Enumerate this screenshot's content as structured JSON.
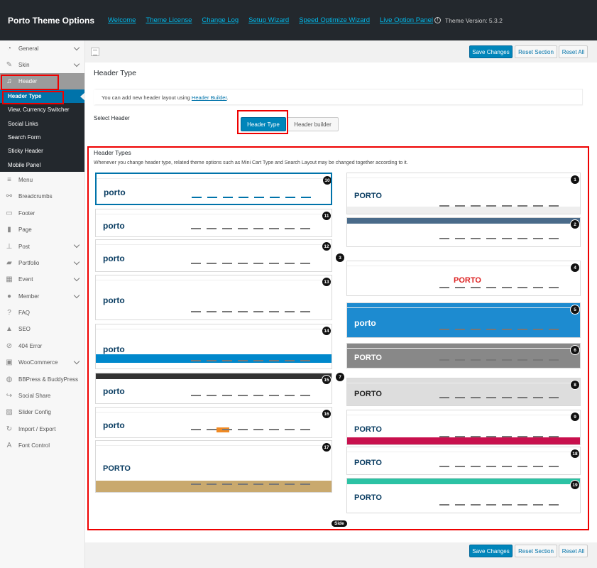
{
  "topbar": {
    "brand": "Porto Theme Options",
    "links": [
      "Welcome",
      "Theme License",
      "Change Log",
      "Setup Wizard",
      "Speed Optimize Wizard",
      "Live Option Panel"
    ],
    "version": "Theme Version: 5.3.2"
  },
  "sidebar": {
    "items": [
      {
        "label": "General",
        "icon": "gauge-icon",
        "chev": true
      },
      {
        "label": "Skin",
        "icon": "brush-icon",
        "chev": true
      },
      {
        "label": "Header",
        "icon": "headphones-icon",
        "chev": false
      }
    ],
    "sub_items": [
      "Header Type",
      "View, Currency Switcher",
      "Social Links",
      "Search Form",
      "Sticky Header",
      "Mobile Panel"
    ],
    "items_after": [
      {
        "label": "Menu",
        "icon": "menu-icon",
        "chev": false
      },
      {
        "label": "Breadcrumbs",
        "icon": "link-icon",
        "chev": false
      },
      {
        "label": "Footer",
        "icon": "layout-icon",
        "chev": false
      },
      {
        "label": "Page",
        "icon": "bookmark-icon",
        "chev": false
      },
      {
        "label": "Post",
        "icon": "thumbtack-icon",
        "chev": true
      },
      {
        "label": "Portfolio",
        "icon": "folder-icon",
        "chev": true
      },
      {
        "label": "Event",
        "icon": "calendar-icon",
        "chev": true
      },
      {
        "label": "Member",
        "icon": "user-icon",
        "chev": true
      },
      {
        "label": "FAQ",
        "icon": "question-icon",
        "chev": false
      },
      {
        "label": "SEO",
        "icon": "thumbs-up-icon",
        "chev": false
      },
      {
        "label": "404 Error",
        "icon": "error-icon",
        "chev": false
      },
      {
        "label": "WooCommerce",
        "icon": "cart-icon",
        "chev": true
      },
      {
        "label": "BBPress & BuddyPress",
        "icon": "group-icon",
        "chev": false
      },
      {
        "label": "Social Share",
        "icon": "share-icon",
        "chev": false
      },
      {
        "label": "Slider Config",
        "icon": "image-icon",
        "chev": false
      },
      {
        "label": "Import / Export",
        "icon": "refresh-icon",
        "chev": false
      },
      {
        "label": "Font Control",
        "icon": "font-icon",
        "chev": false
      }
    ]
  },
  "toolbar": {
    "save": "Save Changes",
    "reset_section": "Reset Section",
    "reset_all": "Reset All"
  },
  "main": {
    "title": "Header Type",
    "notice_prefix": "You can add new header layout using ",
    "notice_link": "Header Builder",
    "notice_suffix": ".",
    "select_label": "Select Header",
    "seg_type": "Header Type",
    "seg_builder": "Header builder",
    "types_title": "Header Types",
    "types_desc": "Whenever you change header type, related theme options such as Mini Cart Type and Search Layout may be changed together according to it.",
    "side_label": "Side",
    "left_thumbs": [
      {
        "num": "10",
        "logo": "porto"
      },
      {
        "num": "11",
        "logo": "porto"
      },
      {
        "num": "12",
        "logo": "porto"
      },
      {
        "num": "13",
        "logo": "porto"
      },
      {
        "num": "14",
        "logo": "porto"
      },
      {
        "num": "15",
        "logo": "porto"
      },
      {
        "num": "16",
        "logo": "porto"
      },
      {
        "num": "17",
        "logo": "PORTO"
      }
    ],
    "right_thumbs": [
      {
        "num": "1",
        "logo": "PORTO"
      },
      {
        "num": "2",
        "logo": ""
      },
      {
        "num": "4",
        "logo": "PORTO"
      },
      {
        "num": "5",
        "logo": "porto"
      },
      {
        "num": "6",
        "logo": "PORTO"
      },
      {
        "num": "8",
        "logo": "PORTO"
      },
      {
        "num": "9",
        "logo": "PORTO"
      },
      {
        "num": "18",
        "logo": "PORTO"
      },
      {
        "num": "19",
        "logo": "PORTO"
      }
    ],
    "mid_badges": [
      "3",
      "7"
    ]
  },
  "colors": {
    "accent": "#0085ba",
    "highlight": "#e00000",
    "topbar": "#23282d"
  }
}
